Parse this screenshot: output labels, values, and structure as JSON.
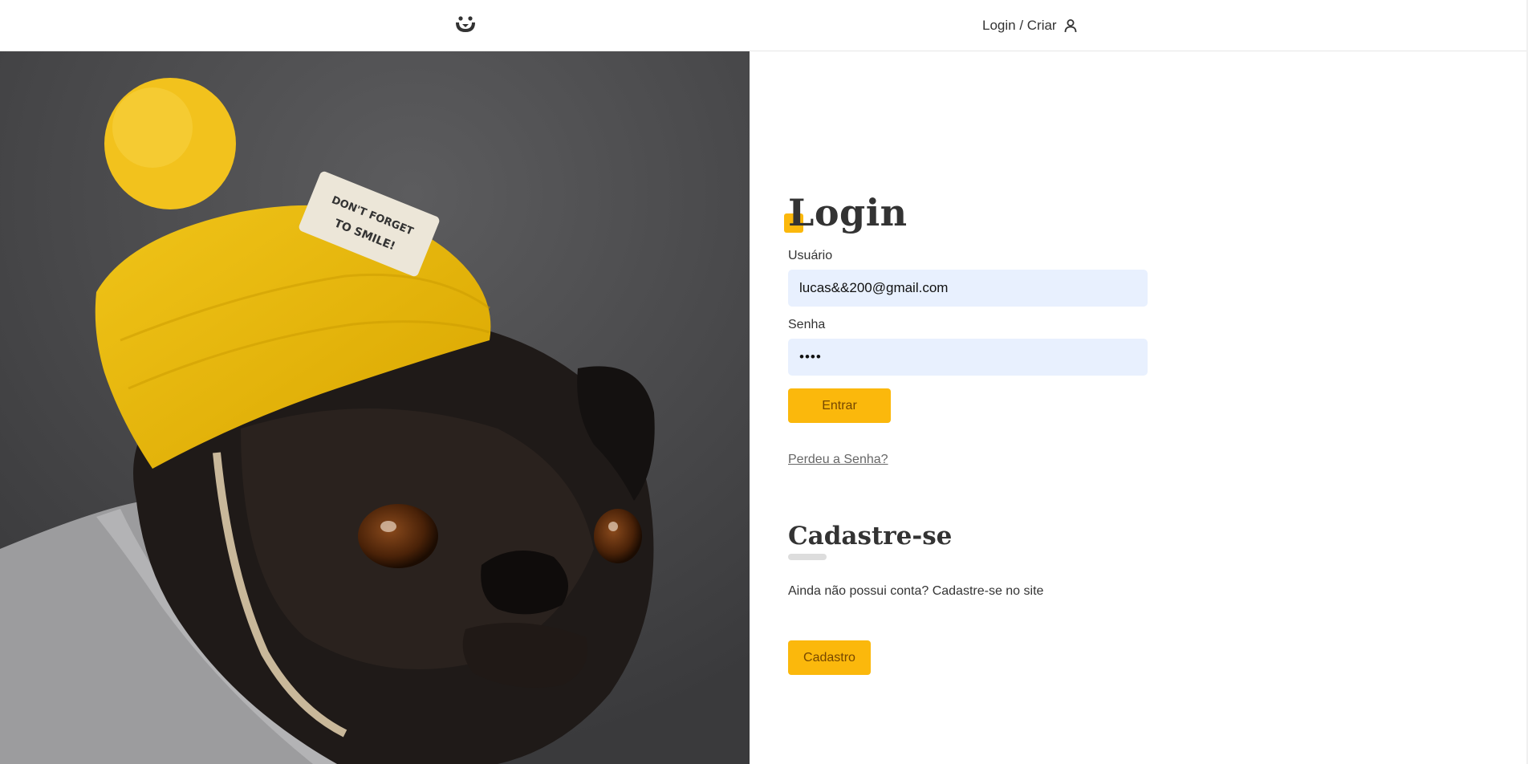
{
  "header": {
    "logo_icon": "dog-face-logo-icon",
    "nav_login_label": "Login / Criar",
    "user_icon": "user-icon"
  },
  "photo": {
    "subject": "pug-with-yellow-beanie-photo",
    "hat_label_text": "DON'T FORGET TO SMILE!"
  },
  "login": {
    "title": "Login",
    "username_label": "Usuário",
    "username_value": "lucas&&200@gmail.com",
    "password_label": "Senha",
    "password_value": "••••",
    "submit_label": "Entrar",
    "lost_password_link": "Perdeu a Senha?"
  },
  "signup": {
    "title": "Cadastre-se",
    "text": "Ainda não possui conta? Cadastre-se no site",
    "button_label": "Cadastro"
  },
  "colors": {
    "accent": "#fbb80c",
    "button_text": "#764701",
    "input_background": "#e8f0fe",
    "text": "#333333"
  }
}
